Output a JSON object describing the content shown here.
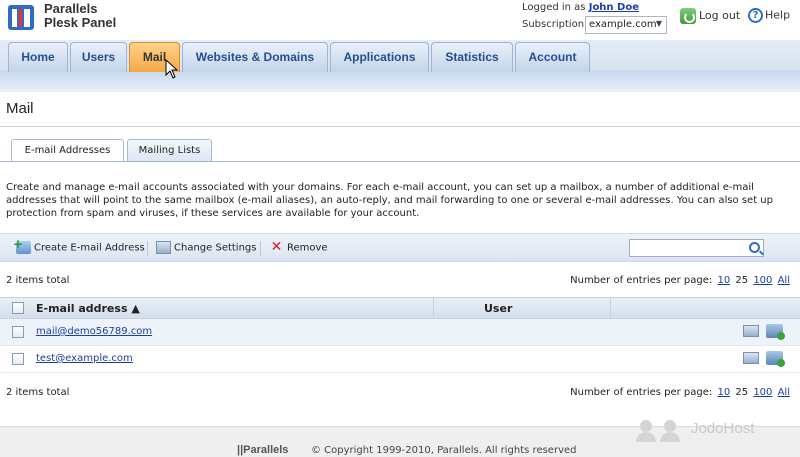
{
  "header": {
    "brand_line1": "Parallels",
    "brand_line2": "Plesk Panel",
    "logged_in_label": "Logged in as",
    "user_name": "John Doe",
    "subscription_label": "Subscription",
    "subscription_value": "example.com",
    "logout_label": "Log out",
    "help_label": "Help"
  },
  "nav": {
    "tabs": [
      "Home",
      "Users",
      "Mail",
      "Websites & Domains",
      "Applications",
      "Statistics",
      "Account"
    ],
    "active": "Mail"
  },
  "page": {
    "title": "Mail",
    "subtabs": [
      "E-mail Addresses",
      "Mailing Lists"
    ],
    "description": "Create and manage e-mail accounts associated with your domains. For each e-mail account, you can set up a mailbox, a number of additional e-mail addresses that will point to the same mailbox (e-mail aliases), an auto-reply, and mail forwarding to one or several e-mail addresses. You can also set up protection from spam and viruses, if these services are available for your account."
  },
  "toolbar": {
    "create_label": "Create E-mail Address",
    "settings_label": "Change Settings",
    "remove_label": "Remove",
    "search_value": ""
  },
  "list": {
    "total_text": "2 items total",
    "per_page_label": "Number of entries per page:",
    "per_page_options": [
      "10",
      "25",
      "100",
      "All"
    ],
    "per_page_current": "25",
    "columns": {
      "email": "E-mail address ▲",
      "user": "User"
    },
    "rows": [
      {
        "email": "mail@demo56789.com",
        "user": ""
      },
      {
        "email": "test@example.com",
        "user": ""
      }
    ]
  },
  "footer": {
    "logo": "||Parallels",
    "copyright": "© Copyright 1999-2010, Parallels. All rights reserved",
    "watermark": "JodoHost"
  }
}
